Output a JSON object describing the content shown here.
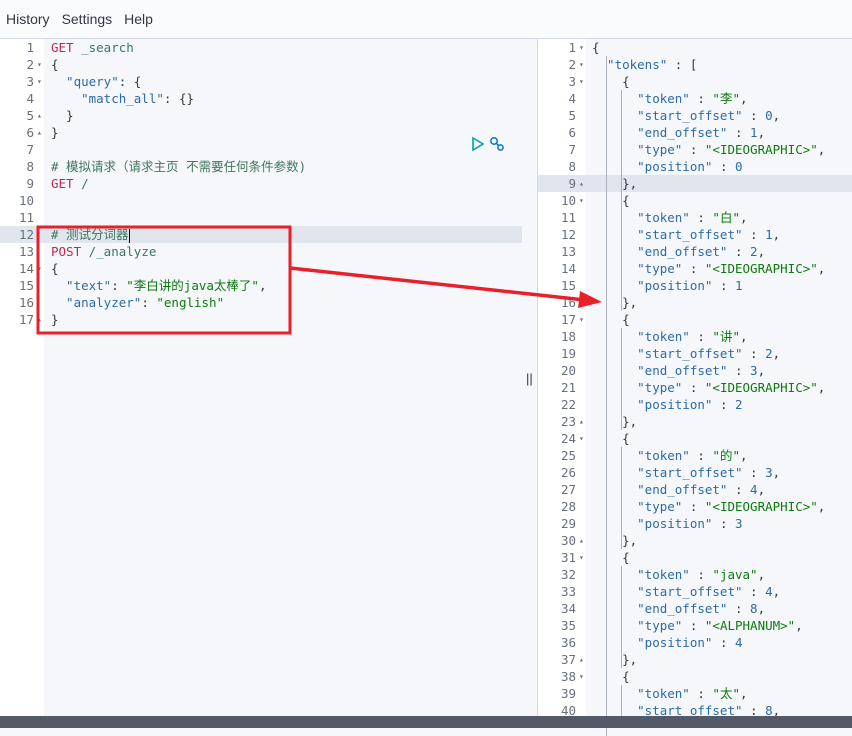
{
  "menu": [
    "History",
    "Settings",
    "Help"
  ],
  "request_editor": {
    "lines": [
      {
        "n": "1",
        "fold": "",
        "parts": [
          [
            "kw",
            "GET"
          ],
          [
            "path",
            " _search"
          ]
        ]
      },
      {
        "n": "2",
        "fold": "▾",
        "parts": [
          [
            "brack",
            "{"
          ]
        ]
      },
      {
        "n": "3",
        "fold": "▾",
        "parts": [
          [
            "key",
            "  \"query\""
          ],
          [
            "punc",
            ": {"
          ]
        ]
      },
      {
        "n": "4",
        "fold": "",
        "parts": [
          [
            "key",
            "    \"match_all\""
          ],
          [
            "punc",
            ": {}"
          ]
        ]
      },
      {
        "n": "5",
        "fold": "▴",
        "parts": [
          [
            "punc",
            "  }"
          ]
        ]
      },
      {
        "n": "6",
        "fold": "▴",
        "parts": [
          [
            "brack",
            "}"
          ]
        ]
      },
      {
        "n": "7",
        "fold": "",
        "parts": []
      },
      {
        "n": "8",
        "fold": "",
        "parts": [
          [
            "com",
            "# 模拟请求（请求主页 不需要任何条件参数)"
          ]
        ]
      },
      {
        "n": "9",
        "fold": "",
        "parts": [
          [
            "kw",
            "GET"
          ],
          [
            "path",
            " /"
          ]
        ]
      },
      {
        "n": "10",
        "fold": "",
        "parts": []
      },
      {
        "n": "11",
        "fold": "",
        "parts": []
      },
      {
        "n": "12",
        "fold": "",
        "parts": [
          [
            "com",
            "# 测试分词器"
          ]
        ]
      },
      {
        "n": "13",
        "fold": "",
        "parts": [
          [
            "kw",
            "POST"
          ],
          [
            "path",
            " /_analyze"
          ]
        ]
      },
      {
        "n": "14",
        "fold": "▾",
        "parts": [
          [
            "brack",
            "{"
          ]
        ]
      },
      {
        "n": "15",
        "fold": "",
        "parts": [
          [
            "key",
            "  \"text\""
          ],
          [
            "punc",
            ": "
          ],
          [
            "str",
            "\"李白讲的java太棒了\""
          ],
          [
            "punc",
            ","
          ]
        ]
      },
      {
        "n": "16",
        "fold": "",
        "parts": [
          [
            "key",
            "  \"analyzer\""
          ],
          [
            "punc",
            ": "
          ],
          [
            "str",
            "\"english\""
          ]
        ]
      },
      {
        "n": "17",
        "fold": "▴",
        "parts": [
          [
            "brack",
            "}"
          ]
        ]
      }
    ],
    "active_line": 12,
    "run_label": "▷",
    "settings_label": "wrench"
  },
  "response_viewer": {
    "lines": [
      {
        "n": "1",
        "fold": "▾",
        "parts": [
          [
            "brack",
            "{"
          ]
        ]
      },
      {
        "n": "2",
        "fold": "▾",
        "parts": [
          [
            "key",
            "  \"tokens\""
          ],
          [
            "punc",
            " : ["
          ]
        ]
      },
      {
        "n": "3",
        "fold": "▾",
        "parts": [
          [
            "punc",
            "    {"
          ]
        ]
      },
      {
        "n": "4",
        "fold": "",
        "parts": [
          [
            "key",
            "      \"token\""
          ],
          [
            "punc",
            " : "
          ],
          [
            "str",
            "\"李\""
          ],
          [
            "punc",
            ","
          ]
        ]
      },
      {
        "n": "5",
        "fold": "",
        "parts": [
          [
            "key",
            "      \"start_offset\""
          ],
          [
            "punc",
            " : "
          ],
          [
            "num",
            "0"
          ],
          [
            "punc",
            ","
          ]
        ]
      },
      {
        "n": "6",
        "fold": "",
        "parts": [
          [
            "key",
            "      \"end_offset\""
          ],
          [
            "punc",
            " : "
          ],
          [
            "num",
            "1"
          ],
          [
            "punc",
            ","
          ]
        ]
      },
      {
        "n": "7",
        "fold": "",
        "parts": [
          [
            "key",
            "      \"type\""
          ],
          [
            "punc",
            " : "
          ],
          [
            "str",
            "\"<IDEOGRAPHIC>\""
          ],
          [
            "punc",
            ","
          ]
        ]
      },
      {
        "n": "8",
        "fold": "",
        "parts": [
          [
            "key",
            "      \"position\""
          ],
          [
            "punc",
            " : "
          ],
          [
            "num",
            "0"
          ]
        ]
      },
      {
        "n": "9",
        "fold": "▴",
        "parts": [
          [
            "punc",
            "    },"
          ]
        ]
      },
      {
        "n": "10",
        "fold": "▾",
        "parts": [
          [
            "punc",
            "    {"
          ]
        ]
      },
      {
        "n": "11",
        "fold": "",
        "parts": [
          [
            "key",
            "      \"token\""
          ],
          [
            "punc",
            " : "
          ],
          [
            "str",
            "\"白\""
          ],
          [
            "punc",
            ","
          ]
        ]
      },
      {
        "n": "12",
        "fold": "",
        "parts": [
          [
            "key",
            "      \"start_offset\""
          ],
          [
            "punc",
            " : "
          ],
          [
            "num",
            "1"
          ],
          [
            "punc",
            ","
          ]
        ]
      },
      {
        "n": "13",
        "fold": "",
        "parts": [
          [
            "key",
            "      \"end_offset\""
          ],
          [
            "punc",
            " : "
          ],
          [
            "num",
            "2"
          ],
          [
            "punc",
            ","
          ]
        ]
      },
      {
        "n": "14",
        "fold": "",
        "parts": [
          [
            "key",
            "      \"type\""
          ],
          [
            "punc",
            " : "
          ],
          [
            "str",
            "\"<IDEOGRAPHIC>\""
          ],
          [
            "punc",
            ","
          ]
        ]
      },
      {
        "n": "15",
        "fold": "",
        "parts": [
          [
            "key",
            "      \"position\""
          ],
          [
            "punc",
            " : "
          ],
          [
            "num",
            "1"
          ]
        ]
      },
      {
        "n": "16",
        "fold": "▴",
        "parts": [
          [
            "punc",
            "    },"
          ]
        ]
      },
      {
        "n": "17",
        "fold": "▾",
        "parts": [
          [
            "punc",
            "    {"
          ]
        ]
      },
      {
        "n": "18",
        "fold": "",
        "parts": [
          [
            "key",
            "      \"token\""
          ],
          [
            "punc",
            " : "
          ],
          [
            "str",
            "\"讲\""
          ],
          [
            "punc",
            ","
          ]
        ]
      },
      {
        "n": "19",
        "fold": "",
        "parts": [
          [
            "key",
            "      \"start_offset\""
          ],
          [
            "punc",
            " : "
          ],
          [
            "num",
            "2"
          ],
          [
            "punc",
            ","
          ]
        ]
      },
      {
        "n": "20",
        "fold": "",
        "parts": [
          [
            "key",
            "      \"end_offset\""
          ],
          [
            "punc",
            " : "
          ],
          [
            "num",
            "3"
          ],
          [
            "punc",
            ","
          ]
        ]
      },
      {
        "n": "21",
        "fold": "",
        "parts": [
          [
            "key",
            "      \"type\""
          ],
          [
            "punc",
            " : "
          ],
          [
            "str",
            "\"<IDEOGRAPHIC>\""
          ],
          [
            "punc",
            ","
          ]
        ]
      },
      {
        "n": "22",
        "fold": "",
        "parts": [
          [
            "key",
            "      \"position\""
          ],
          [
            "punc",
            " : "
          ],
          [
            "num",
            "2"
          ]
        ]
      },
      {
        "n": "23",
        "fold": "▴",
        "parts": [
          [
            "punc",
            "    },"
          ]
        ]
      },
      {
        "n": "24",
        "fold": "▾",
        "parts": [
          [
            "punc",
            "    {"
          ]
        ]
      },
      {
        "n": "25",
        "fold": "",
        "parts": [
          [
            "key",
            "      \"token\""
          ],
          [
            "punc",
            " : "
          ],
          [
            "str",
            "\"的\""
          ],
          [
            "punc",
            ","
          ]
        ]
      },
      {
        "n": "26",
        "fold": "",
        "parts": [
          [
            "key",
            "      \"start_offset\""
          ],
          [
            "punc",
            " : "
          ],
          [
            "num",
            "3"
          ],
          [
            "punc",
            ","
          ]
        ]
      },
      {
        "n": "27",
        "fold": "",
        "parts": [
          [
            "key",
            "      \"end_offset\""
          ],
          [
            "punc",
            " : "
          ],
          [
            "num",
            "4"
          ],
          [
            "punc",
            ","
          ]
        ]
      },
      {
        "n": "28",
        "fold": "",
        "parts": [
          [
            "key",
            "      \"type\""
          ],
          [
            "punc",
            " : "
          ],
          [
            "str",
            "\"<IDEOGRAPHIC>\""
          ],
          [
            "punc",
            ","
          ]
        ]
      },
      {
        "n": "29",
        "fold": "",
        "parts": [
          [
            "key",
            "      \"position\""
          ],
          [
            "punc",
            " : "
          ],
          [
            "num",
            "3"
          ]
        ]
      },
      {
        "n": "30",
        "fold": "▴",
        "parts": [
          [
            "punc",
            "    },"
          ]
        ]
      },
      {
        "n": "31",
        "fold": "▾",
        "parts": [
          [
            "punc",
            "    {"
          ]
        ]
      },
      {
        "n": "32",
        "fold": "",
        "parts": [
          [
            "key",
            "      \"token\""
          ],
          [
            "punc",
            " : "
          ],
          [
            "str",
            "\"java\""
          ],
          [
            "punc",
            ","
          ]
        ]
      },
      {
        "n": "33",
        "fold": "",
        "parts": [
          [
            "key",
            "      \"start_offset\""
          ],
          [
            "punc",
            " : "
          ],
          [
            "num",
            "4"
          ],
          [
            "punc",
            ","
          ]
        ]
      },
      {
        "n": "34",
        "fold": "",
        "parts": [
          [
            "key",
            "      \"end_offset\""
          ],
          [
            "punc",
            " : "
          ],
          [
            "num",
            "8"
          ],
          [
            "punc",
            ","
          ]
        ]
      },
      {
        "n": "35",
        "fold": "",
        "parts": [
          [
            "key",
            "      \"type\""
          ],
          [
            "punc",
            " : "
          ],
          [
            "str",
            "\"<ALPHANUM>\""
          ],
          [
            "punc",
            ","
          ]
        ]
      },
      {
        "n": "36",
        "fold": "",
        "parts": [
          [
            "key",
            "      \"position\""
          ],
          [
            "punc",
            " : "
          ],
          [
            "num",
            "4"
          ]
        ]
      },
      {
        "n": "37",
        "fold": "▴",
        "parts": [
          [
            "punc",
            "    },"
          ]
        ]
      },
      {
        "n": "38",
        "fold": "▾",
        "parts": [
          [
            "punc",
            "    {"
          ]
        ]
      },
      {
        "n": "39",
        "fold": "",
        "parts": [
          [
            "key",
            "      \"token\""
          ],
          [
            "punc",
            " : "
          ],
          [
            "str",
            "\"太\""
          ],
          [
            "punc",
            ","
          ]
        ]
      },
      {
        "n": "40",
        "fold": "",
        "parts": [
          [
            "key",
            "      \"start_offset\""
          ],
          [
            "punc",
            " : "
          ],
          [
            "num",
            "8"
          ],
          [
            "punc",
            ","
          ]
        ]
      }
    ],
    "active_line": 9
  },
  "divider_handle": "||",
  "annotation": {
    "color": "#e8202a"
  }
}
